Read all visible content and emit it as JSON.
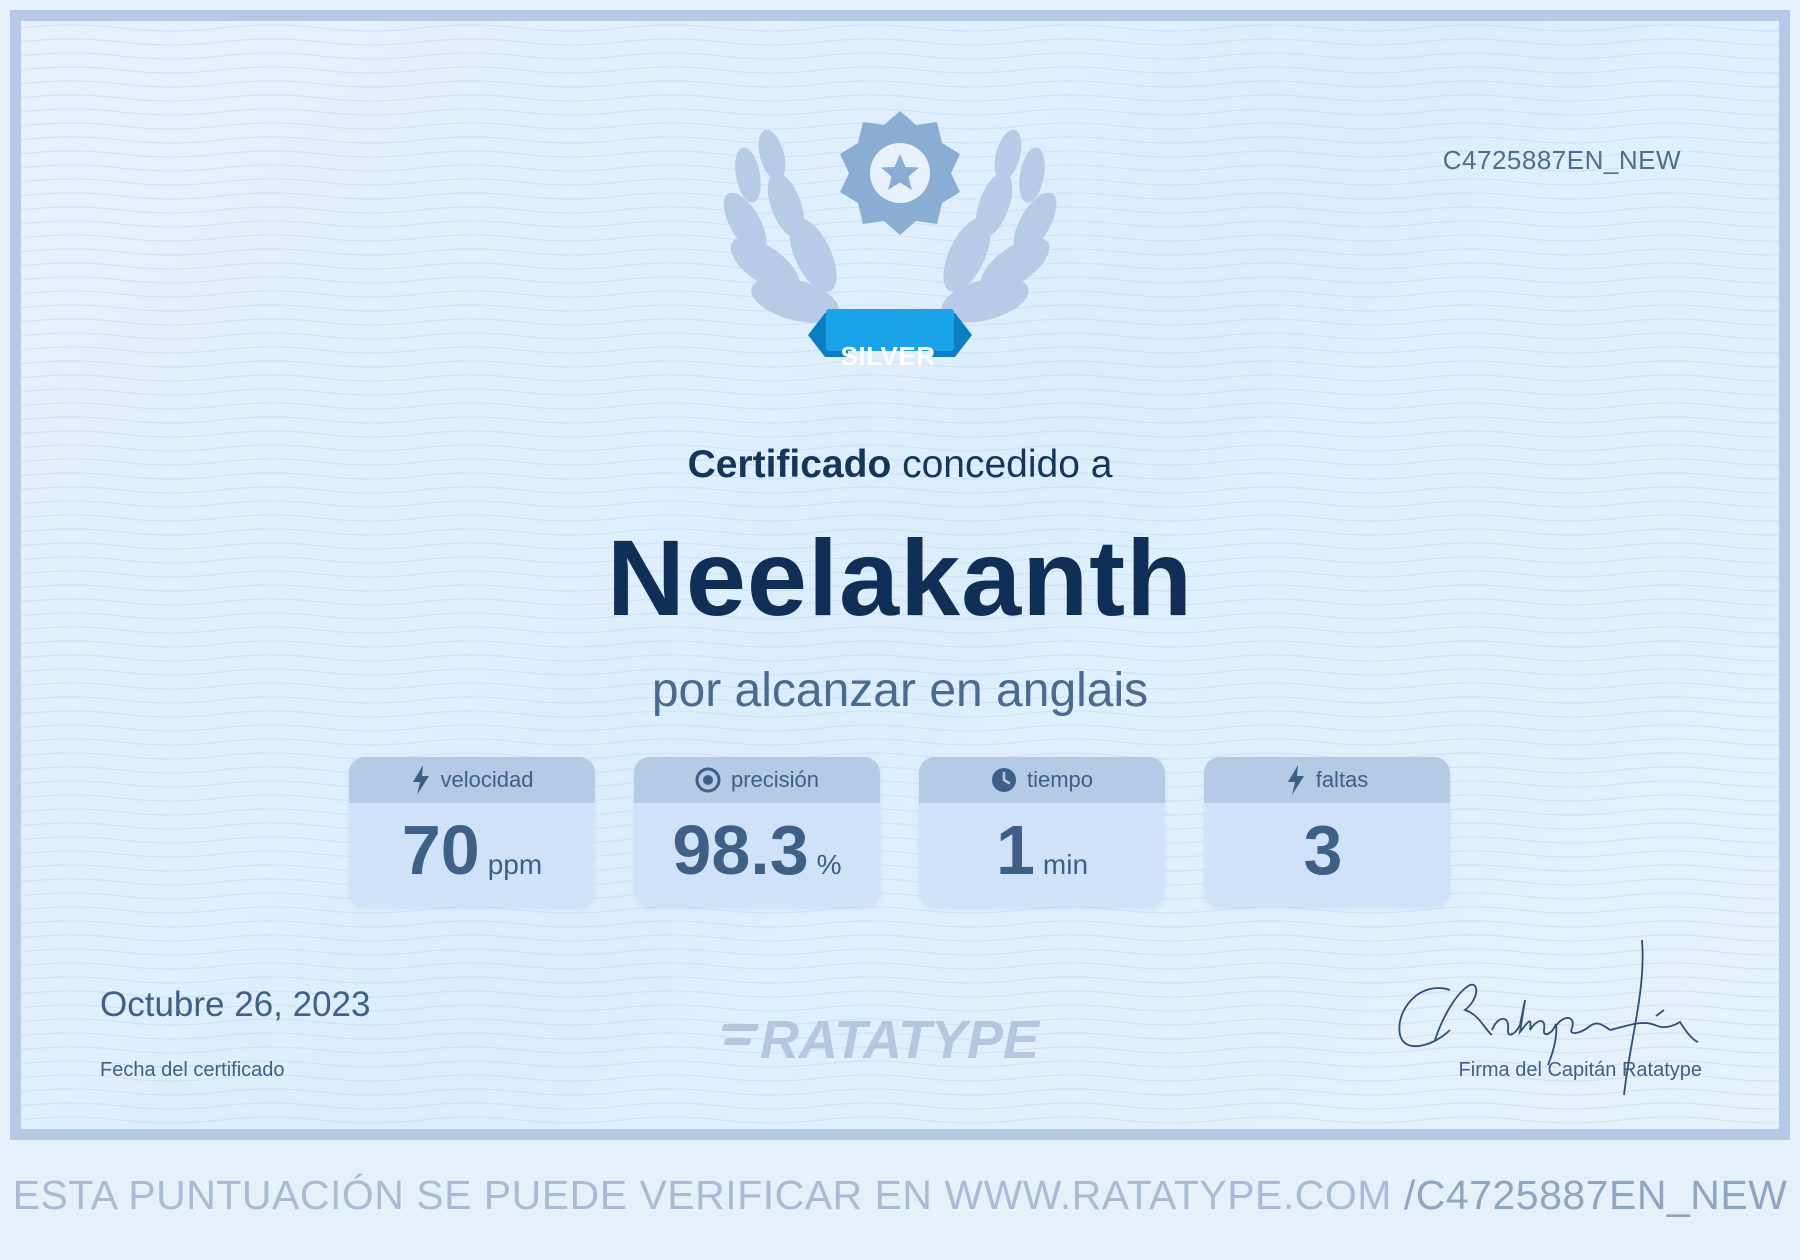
{
  "certificate": {
    "id": "C4725887EN_NEW",
    "badge_label": "SILVER",
    "awarded_strong": "Certificado",
    "awarded_rest": " concedido a",
    "recipient": "Neelakanth",
    "subtitle": "por alcanzar en anglais",
    "date": "Octubre 26, 2023",
    "date_caption": "Fecha del certificado",
    "logo": "RATATYPE",
    "signature_caption": "Firma del Capitán Ratatype",
    "verify_text": "ESTA PUNTUACIÓN SE PUEDE VERIFICAR EN WWW.RATATYPE.COM",
    "verify_code": "/C4725887EN_NEW"
  },
  "stats": [
    {
      "label": "velocidad",
      "icon": "lightning-icon",
      "value": "70",
      "unit": "ppm"
    },
    {
      "label": "precisión",
      "icon": "target-icon",
      "value": "98.3",
      "unit": "%"
    },
    {
      "label": "tiempo",
      "icon": "clock-icon",
      "value": "1",
      "unit": "min"
    },
    {
      "label": "faltas",
      "icon": "lightning-icon",
      "value": "3",
      "unit": ""
    }
  ],
  "colors": {
    "frame": "#b5c9e4",
    "ink_dark": "#0f2f57",
    "ink_mid": "#4a6a92",
    "badge_ribbon": "#1aa3e8",
    "emblem": "#8aaed3",
    "laurel": "#b5c9e4"
  }
}
